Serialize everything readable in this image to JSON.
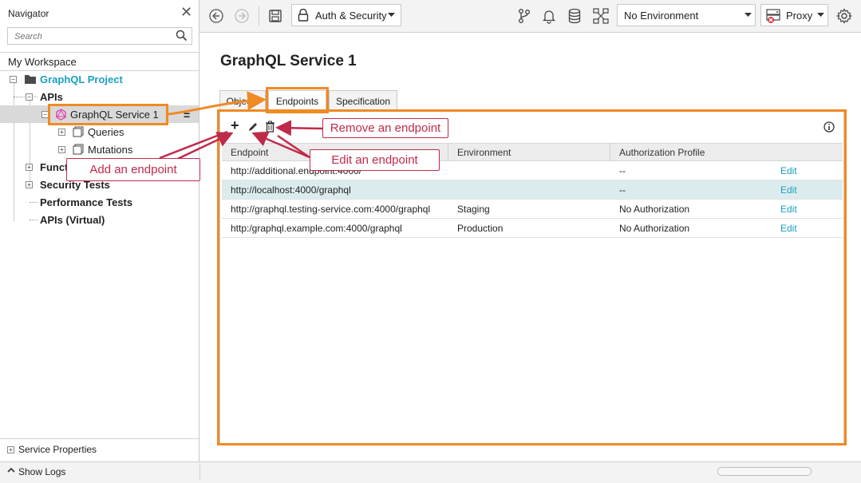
{
  "navigator": {
    "title": "Navigator",
    "search_placeholder": "Search",
    "workspace": "My Workspace",
    "tree": {
      "project": "GraphQL Project",
      "apis": "APIs",
      "service": "GraphQL Service 1",
      "queries": "Queries",
      "mutations": "Mutations",
      "functional": "Funct",
      "security": "Security Tests",
      "performance": "Performance Tests",
      "virtual": "APIs (Virtual)"
    },
    "service_properties": "Service Properties",
    "show_logs": "Show Logs"
  },
  "toolbar": {
    "auth_label": "Auth & Security",
    "environment": "No Environment",
    "proxy": "Proxy"
  },
  "main": {
    "title": "GraphQL Service 1",
    "tabs": [
      "Objects",
      "Endpoints",
      "Specification"
    ],
    "active_tab": "Endpoints",
    "columns": [
      "Endpoint",
      "Environment",
      "Authorization Profile"
    ],
    "rows": [
      {
        "endpoint": "http://additional.endpoint:4000/",
        "environment": "",
        "auth": "--",
        "action": "Edit"
      },
      {
        "endpoint": "http://localhost:4000/graphql",
        "environment": "",
        "auth": "--",
        "action": "Edit"
      },
      {
        "endpoint": "http://graphql.testing-service.com:4000/graphql",
        "environment": "Staging",
        "auth": "No Authorization",
        "action": "Edit"
      },
      {
        "endpoint": "http:/graphql.example.com:4000/graphql",
        "environment": "Production",
        "auth": "No Authorization",
        "action": "Edit"
      }
    ]
  },
  "annotations": {
    "remove": "Remove an endpoint",
    "edit": "Edit an endpoint",
    "add": "Add an endpoint"
  },
  "colors": {
    "accent_orange": "#f08a24",
    "callout_red": "#c02a4a",
    "link_teal": "#1a9fbf",
    "project_teal": "#1a9fbf",
    "selected_row": "#dcecee"
  }
}
